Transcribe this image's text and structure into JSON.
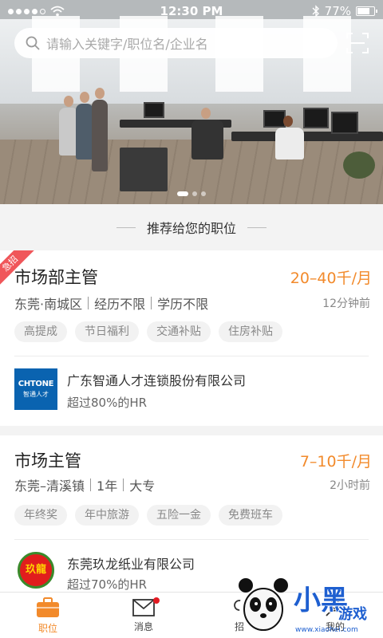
{
  "status_bar": {
    "time": "12:30 PM",
    "battery": "77%",
    "battery_level": 0.77,
    "signal_bars": 4
  },
  "search": {
    "placeholder": "请输入关键字/职位名/企业名"
  },
  "section": {
    "title": "推荐给您的职位"
  },
  "jobs": [
    {
      "urgent_badge": "急招",
      "title": "市场部主管",
      "salary": "20–40千/月",
      "location": "东莞·南城区",
      "experience": "经历不限",
      "education": "学历不限",
      "posted": "12分钟前",
      "tags": [
        "高提成",
        "节日福利",
        "交通补贴",
        "住房补贴"
      ],
      "company": "广东智通人才连锁股份有限公司",
      "hr_stat": "超过80%的HR",
      "logo_text": "CHTONE",
      "logo_subtext": "智通人才"
    },
    {
      "title": "市场主管",
      "salary": "7–10千/月",
      "location": "东莞–清溪镇",
      "experience": "1年",
      "education": "大专",
      "posted": "2小时前",
      "tags": [
        "年终奖",
        "年中旅游",
        "五险一金",
        "免费班车"
      ],
      "company": "东莞玖龙纸业有限公司",
      "hr_stat": "超过70%的HR",
      "logo_text": "玖龍"
    }
  ],
  "tabbar": [
    {
      "label": "职位",
      "icon": "briefcase-icon",
      "active": true
    },
    {
      "label": "消息",
      "icon": "mail-icon",
      "badge": true
    },
    {
      "label": "招",
      "icon": "recruit-icon"
    },
    {
      "label": "我的",
      "icon": "profile-icon"
    }
  ],
  "watermark": {
    "text": "小黑游戏",
    "url": "www.xiaohei.com"
  },
  "colors": {
    "accent": "#f28a2b",
    "urgent": "#f0565a",
    "badge": "#e31b23"
  }
}
